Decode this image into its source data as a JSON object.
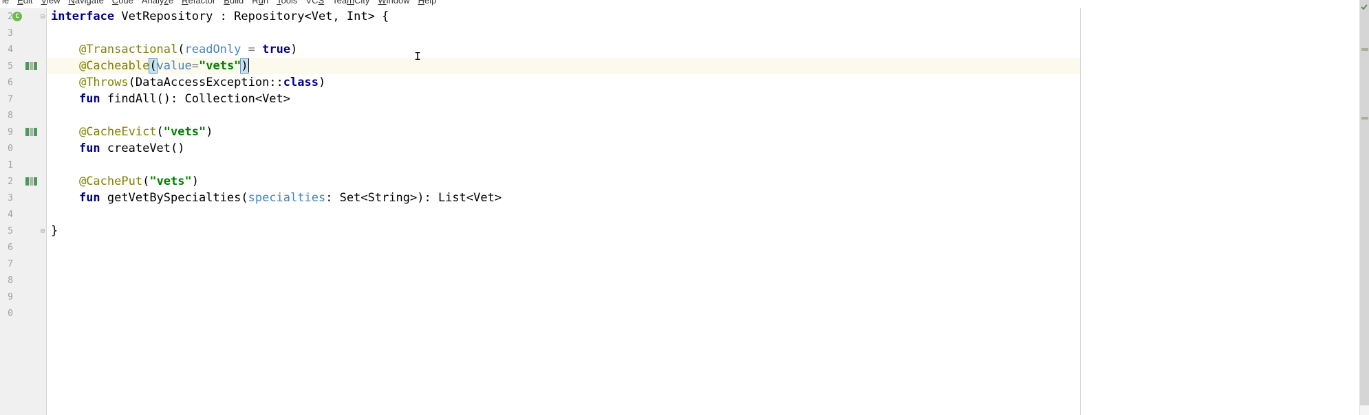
{
  "menu": {
    "file": "le",
    "edit": "Edit",
    "view": "View",
    "navigate": "Navigate",
    "code": "Code",
    "analyze": "Analyze",
    "refactor": "Refactor",
    "build": "Build",
    "run": "Run",
    "tools": "Tools",
    "vcs": "VCS",
    "teamcity": "TeamCity",
    "window": "Window",
    "help": "Help"
  },
  "lines": {
    "l2": "2",
    "l3": "3",
    "l4": "4",
    "l5": "5",
    "l6": "6",
    "l7": "7",
    "l8": "8",
    "l9": "9",
    "l0": "0",
    "l1": "1",
    "l2b": "2",
    "l3b": "3",
    "l4b": "4",
    "l5b": "5",
    "l6b": "6",
    "l7b": "7",
    "l8b": "8",
    "l9b": "9",
    "l0b": "0"
  },
  "code": {
    "kw_interface": "interface",
    "repo_name": " VetRepository ",
    "repo_ext": ": Repository<Vet, Int> {",
    "ann_transactional": "@Transactional",
    "paren_open": "(",
    "param_readonly": "readOnly",
    "eq": " = ",
    "kw_true": "true",
    "paren_close": ")",
    "ann_cacheable": "@Cacheable",
    "param_value": "value",
    "eq2": "=",
    "str_vets": "\"vets\"",
    "ann_throws": "@Throws",
    "throws_body": "(DataAccessException::",
    "kw_class": "class",
    "kw_fun": "fun",
    "fn_findall": " findAll(): Collection<Vet>",
    "ann_cacheevict": "@CacheEvict",
    "ce_body_open": "(",
    "ce_body_close": ")",
    "fn_createvet": " createVet()",
    "ann_cacheput": "@CachePut",
    "cp_body_open": "(",
    "cp_body_close": ")",
    "fn_getvet": " getVetBySpecialties(",
    "param_spec": "specialties",
    "getvet_sig": ": Set<String>): List<Vet>",
    "close_brace": "}"
  }
}
